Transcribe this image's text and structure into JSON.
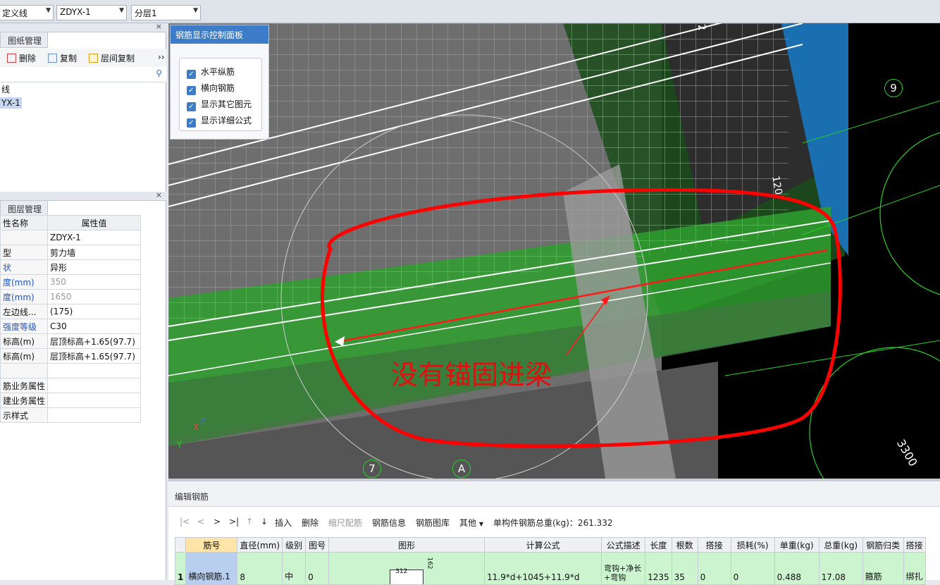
{
  "toolbar": {
    "combo1": "定义线",
    "combo2": "ZDYX-1",
    "combo3": "分层1"
  },
  "drawing_panel": {
    "tab": "图纸管理",
    "buttons": [
      "删除",
      "复制",
      "层间复制"
    ],
    "tree": [
      "线",
      "YX-1"
    ]
  },
  "layer_panel": {
    "tab": "图层管理",
    "col_name": "性名称",
    "col_value": "属性值",
    "rows": [
      [
        "",
        "ZDYX-1"
      ],
      [
        "型",
        "剪力墙"
      ],
      [
        "状",
        "异形"
      ],
      [
        "度(mm)",
        "350"
      ],
      [
        "度(mm)",
        "1650"
      ],
      [
        "左边线...",
        "(175)"
      ],
      [
        "强度等级",
        "C30"
      ],
      [
        "标高(m)",
        "层顶标高+1.65(97.7)"
      ],
      [
        "标高(m)",
        "层顶标高+1.65(97.7)"
      ],
      [
        "",
        ""
      ],
      [
        "筋业务属性",
        ""
      ],
      [
        "建业务属性",
        ""
      ],
      [
        "示样式",
        ""
      ]
    ]
  },
  "control_panel": {
    "title": "钢筋显示控制面板",
    "items": [
      "水平纵筋",
      "横向钢筋",
      "显示其它图元",
      "显示详细公式"
    ]
  },
  "viewport": {
    "annotation": "没有锚固进梁",
    "axis_labels": [
      "7",
      "A",
      "9"
    ],
    "dims": [
      "3300",
      "120",
      "2"
    ],
    "axes": [
      "Z",
      "X",
      "Y"
    ]
  },
  "edit_panel": {
    "title": "编辑钢筋",
    "buttons": [
      "|<",
      "<",
      ">",
      ">|",
      "↑",
      "↓",
      "插入",
      "删除",
      "缩尺配筋",
      "钢筋信息",
      "钢筋图库",
      "其他",
      "单构件钢筋总重(kg)：261.332"
    ],
    "headers": [
      "筋号",
      "直径(mm)",
      "级别",
      "图号",
      "图形",
      "计算公式",
      "公式描述",
      "长度",
      "根数",
      "搭接",
      "损耗(%)",
      "单重(kg)",
      "总重(kg)",
      "钢筋归类",
      "搭接"
    ],
    "row": {
      "idx": "1",
      "cells": [
        "横向钢筋.1",
        "8",
        "中",
        "0",
        "",
        "11.9*d+1045+11.9*d",
        "弯钩+净长+弯钩",
        "1235",
        "35",
        "0",
        "0",
        "0.488",
        "17.08",
        "箍筋",
        "绑扎"
      ],
      "shape_a": "312",
      "shape_b": "162"
    }
  }
}
